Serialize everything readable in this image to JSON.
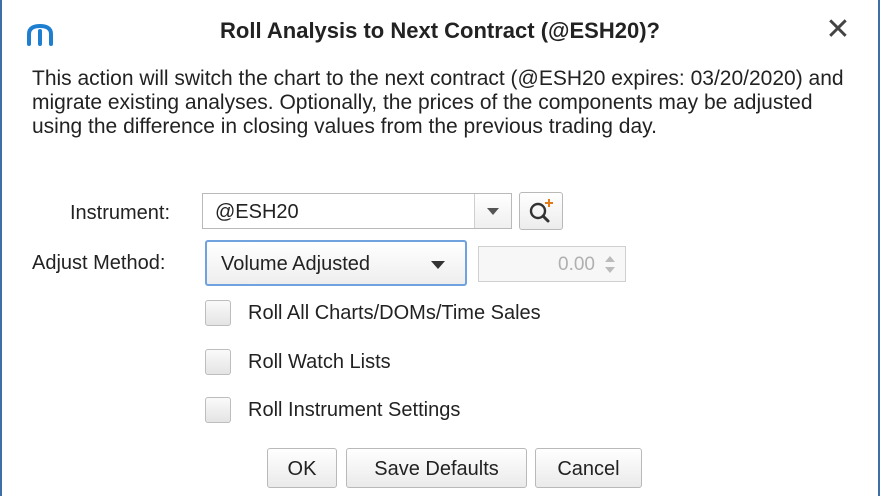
{
  "dialog": {
    "title": "Roll Analysis to Next Contract (@ESH20)?",
    "close_glyph": "✕",
    "description": "This action will switch the chart to the next contract (@ESH20 expires: 03/20/2020) and migrate existing analyses.  Optionally, the prices of the components may be adjusted using the difference in closing values from the previous trading day."
  },
  "form": {
    "instrument_label": "Instrument:",
    "instrument_value": "@ESH20",
    "adjust_label": "Adjust Method:",
    "adjust_value": "Volume Adjusted",
    "adjust_amount": "0.00"
  },
  "checkboxes": [
    {
      "label": "Roll All Charts/DOMs/Time Sales",
      "checked": false
    },
    {
      "label": "Roll Watch Lists",
      "checked": false
    },
    {
      "label": "Roll Instrument Settings",
      "checked": false
    }
  ],
  "buttons": {
    "ok": "OK",
    "save_defaults": "Save Defaults",
    "cancel": "Cancel"
  },
  "icons": {
    "app": "app-logo-icon",
    "search": "search-add-icon",
    "close": "close-icon"
  },
  "colors": {
    "frame_border": "#3f6fa8",
    "app_logo": "#1e7fd0",
    "focus_border": "#6fa2df",
    "search_plus": "#e07a1a"
  }
}
